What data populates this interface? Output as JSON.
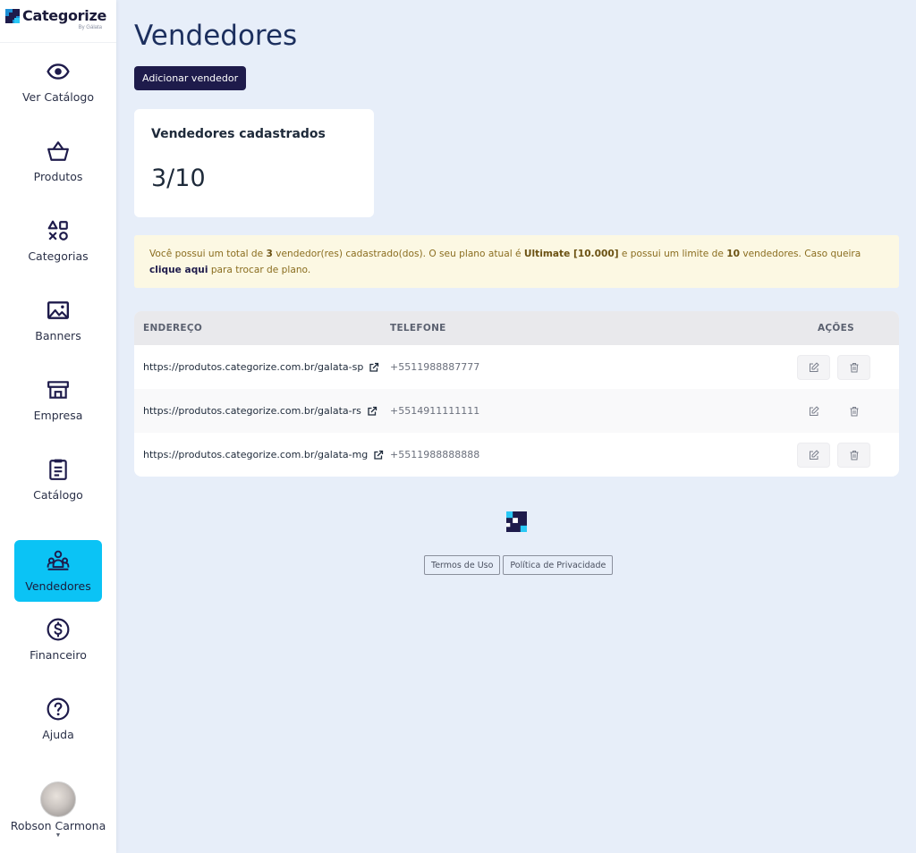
{
  "brand": {
    "name": "Categorize",
    "sub": "By Gálata"
  },
  "sidebar": {
    "items": [
      {
        "label": "Ver Catálogo",
        "icon": "eye-icon"
      },
      {
        "label": "Produtos",
        "icon": "basket-icon"
      },
      {
        "label": "Categorias",
        "icon": "shapes-icon"
      },
      {
        "label": "Banners",
        "icon": "image-icon"
      },
      {
        "label": "Empresa",
        "icon": "store-icon"
      },
      {
        "label": "Catálogo",
        "icon": "clipboard-icon"
      },
      {
        "label": "Vendedores",
        "icon": "users-icon",
        "active": true
      },
      {
        "label": "Financeiro",
        "icon": "dollar-circle-icon"
      },
      {
        "label": "Ajuda",
        "icon": "help-circle-icon"
      }
    ],
    "user": {
      "name": "Robson Carmona"
    }
  },
  "page": {
    "title": "Vendedores",
    "add_button": "Adicionar vendedor"
  },
  "stats": {
    "title": "Vendedores cadastrados",
    "value": "3/10"
  },
  "notice": {
    "part1": "Você possui um total de ",
    "count": "3",
    "part2": " vendedor(res) cadastrado(dos). O seu plano atual é ",
    "plan": "Ultimate [10.000]",
    "part3": " e possui um limite de ",
    "limit": "10",
    "part4": " vendedores. Caso queira ",
    "link": "clique aqui",
    "part5": " para trocar de plano."
  },
  "table": {
    "headers": {
      "address": "ENDEREÇO",
      "phone": "TELEFONE",
      "actions": "AÇÕES"
    },
    "rows": [
      {
        "address": "https://produtos.categorize.com.br/galata-sp",
        "phone": "+5511988887777"
      },
      {
        "address": "https://produtos.categorize.com.br/galata-rs",
        "phone": "+5514911111111"
      },
      {
        "address": "https://produtos.categorize.com.br/galata-mg",
        "phone": "+5511988888888"
      }
    ]
  },
  "footer": {
    "terms": "Termos de Uso",
    "privacy": "Política de Privacidade"
  },
  "colors": {
    "accent": "#0bc3f5",
    "primary": "#1e1b4b",
    "background": "#e7eef9",
    "notice_bg": "#fcf8e3"
  }
}
